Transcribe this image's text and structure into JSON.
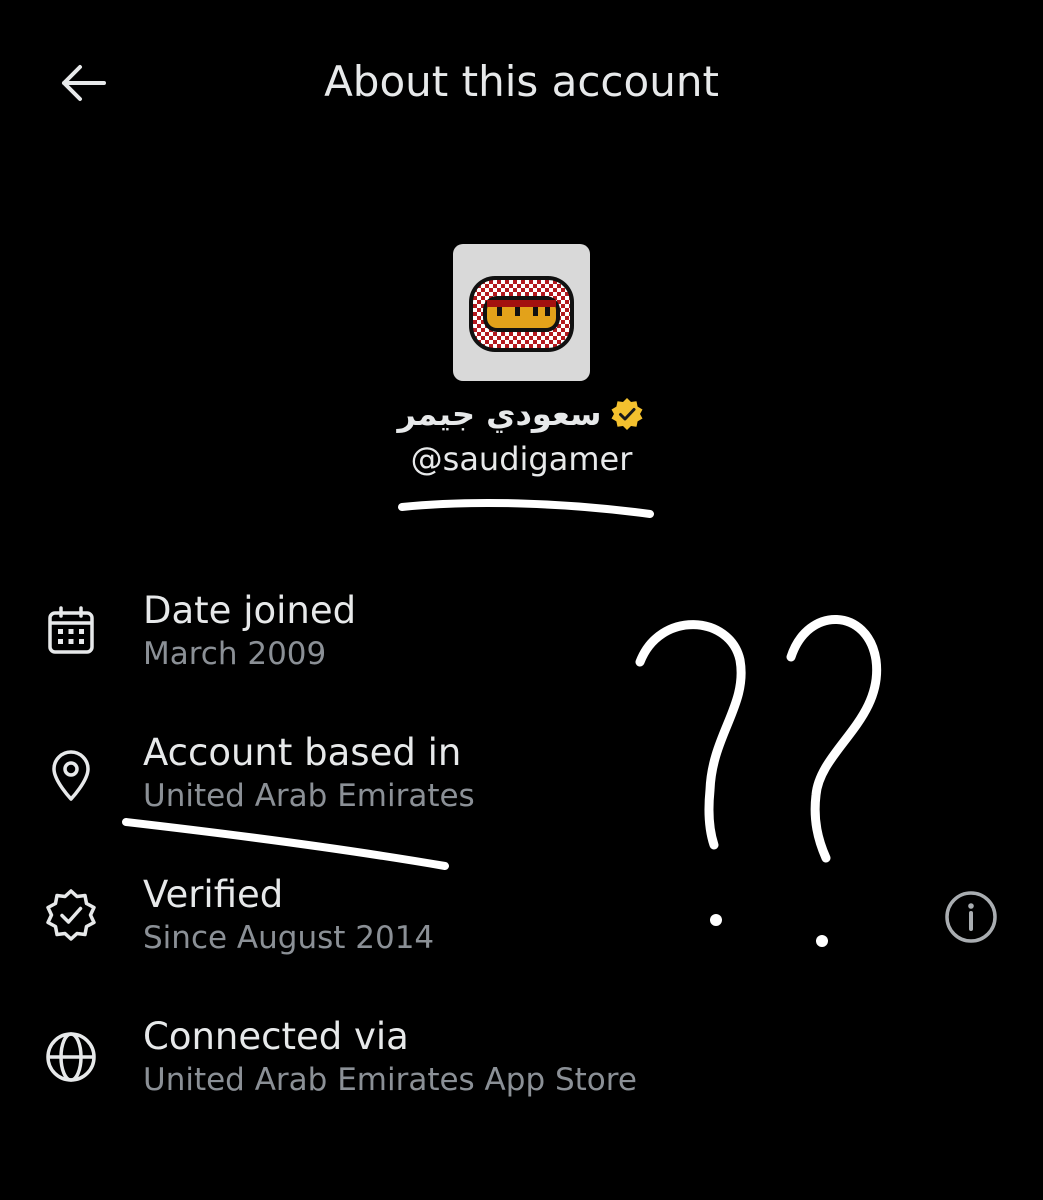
{
  "header": {
    "back_icon": "arrow-left-icon",
    "title": "About this account"
  },
  "profile": {
    "display_name": "سعودي جيمر",
    "handle": "@saudigamer",
    "verified_badge_icon": "gold-verified-badge-icon",
    "verified_badge_color": "#f4c12e"
  },
  "details": [
    {
      "icon": "calendar-icon",
      "label": "Date joined",
      "value": "March 2009"
    },
    {
      "icon": "location-pin-icon",
      "label": "Account based in",
      "value": "United Arab Emirates"
    },
    {
      "icon": "verified-outline-icon",
      "label": "Verified",
      "value": "Since August 2014"
    },
    {
      "icon": "globe-icon",
      "label": "Connected via",
      "value": "United Arab Emirates App Store"
    }
  ],
  "info_button_icon": "info-circle-icon",
  "annotations": {
    "marks": "??",
    "color": "#ffffff"
  },
  "colors": {
    "background": "#000000",
    "primary_text": "#e7e9ea",
    "secondary_text": "#8b9096"
  }
}
